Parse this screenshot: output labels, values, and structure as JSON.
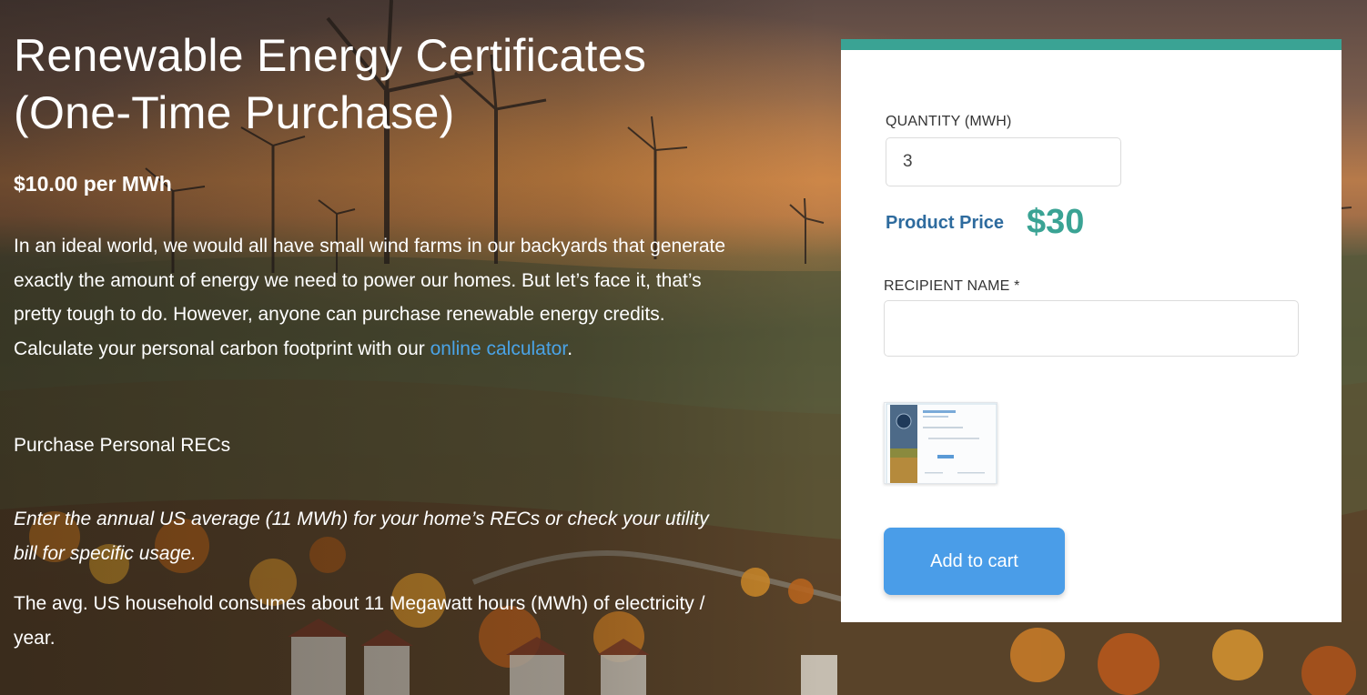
{
  "product": {
    "title": "Renewable Energy Certificates (One-Time Purchase)",
    "price_per_unit": "$10.00 per MWh",
    "description_text": "In an ideal world, we would all have small wind farms in our backyards that generate exactly the amount of energy we need to power our homes. But let’s face it, that’s pretty tough to do. However, anyone can purchase renewable energy credits.  Calculate your personal carbon footprint with our ",
    "description_link": "online calculator",
    "description_end": ".",
    "purchase_heading": "Purchase Personal RECs",
    "instruction": "Enter the annual US average (11 MWh) for your home’s RECs or check your utility bill for specific usage.",
    "household_note": "The avg. US household consumes about 11 Megawatt hours (MWh) of electricity / year."
  },
  "form": {
    "quantity_label": "QUANTITY (MWH)",
    "quantity_value": "3",
    "product_price_label": "Product Price",
    "product_price_value": "$30",
    "recipient_label": "RECIPIENT NAME *",
    "recipient_value": "",
    "add_to_cart_label": "Add to cart"
  },
  "colors": {
    "accent_teal": "#3aa394",
    "button_blue": "#4a9de8",
    "link_blue": "#4aa3e6",
    "price_label_blue": "#2e6b9e"
  },
  "icons": {
    "certificate_thumbnail": "certificate-preview-image"
  }
}
